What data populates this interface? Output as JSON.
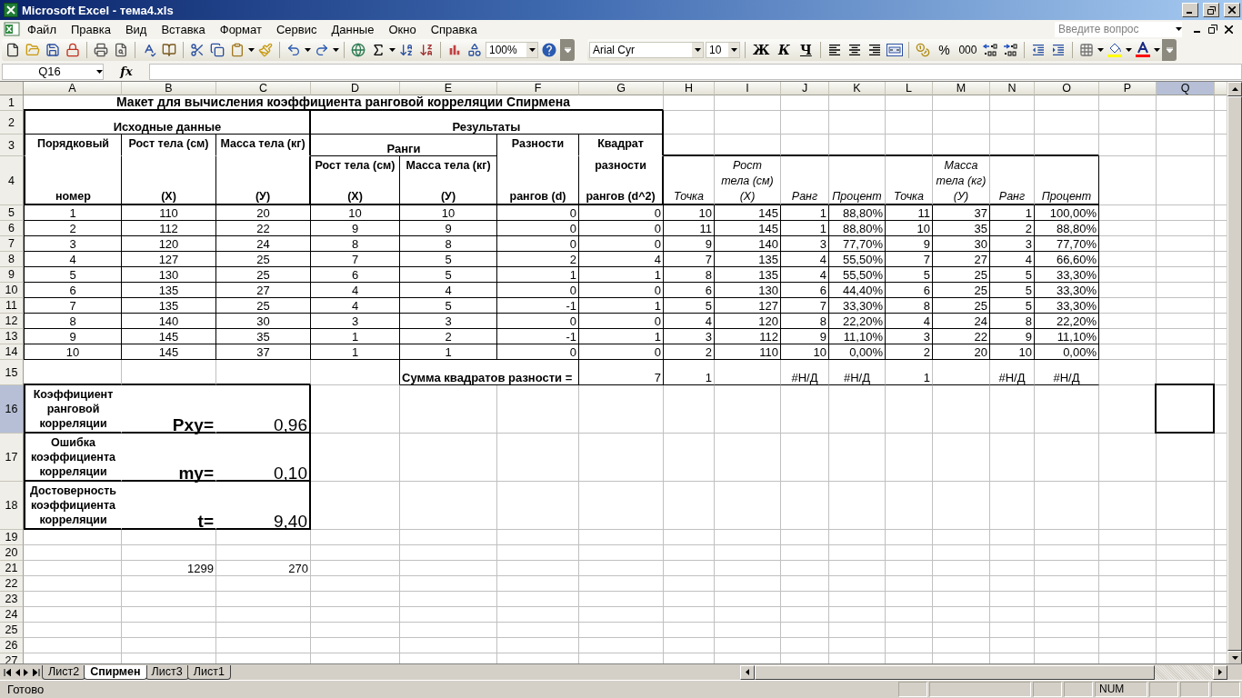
{
  "window": {
    "title": "Microsoft Excel - тема4.xls"
  },
  "menu": [
    "Файл",
    "Правка",
    "Вид",
    "Вставка",
    "Формат",
    "Сервис",
    "Данные",
    "Окно",
    "Справка"
  ],
  "help_search": {
    "placeholder": "Введите вопрос"
  },
  "standard_toolbar": {
    "zoom": "100%"
  },
  "formatting_toolbar": {
    "font": "Arial Cyr",
    "size": "10",
    "bold": "Ж",
    "italic": "К",
    "underline": "Ч",
    "percent": "%",
    "thousands": "000"
  },
  "formula_bar": {
    "name_box": "Q16",
    "fx": "fx"
  },
  "sheet": {
    "columns": [
      {
        "label": "A",
        "selected": false
      },
      {
        "label": "B",
        "selected": false
      },
      {
        "label": "C",
        "selected": false
      },
      {
        "label": "D",
        "selected": false
      },
      {
        "label": "E",
        "selected": false
      },
      {
        "label": "F",
        "selected": false
      },
      {
        "label": "G",
        "selected": false
      },
      {
        "label": "H",
        "selected": false
      },
      {
        "label": "I",
        "selected": false
      },
      {
        "label": "J",
        "selected": false
      },
      {
        "label": "K",
        "selected": false
      },
      {
        "label": "L",
        "selected": false
      },
      {
        "label": "M",
        "selected": false
      },
      {
        "label": "N",
        "selected": false
      },
      {
        "label": "O",
        "selected": false
      },
      {
        "label": "P",
        "selected": false
      },
      {
        "label": "Q",
        "selected": true
      }
    ],
    "rows": [
      {
        "label": "1",
        "selected": false,
        "cells": [
          {
            "text": "Макет для вычисления коэффициента ранговой корреляции  Спирмена",
            "kind": "title"
          }
        ]
      },
      {
        "label": "2",
        "selected": false,
        "cells": [
          {
            "text": "Исходные данные",
            "kind": "group"
          },
          null,
          null,
          {
            "text": "Результаты",
            "kind": "group"
          }
        ]
      },
      {
        "label": "3",
        "selected": false,
        "cells": [
          {
            "text": "Порядковый",
            "kind": "head-top"
          },
          {
            "text": "Рост  тела  (см)",
            "kind": "head-top"
          },
          {
            "text": "Масса тела (кг)",
            "kind": "head-top"
          },
          {
            "text": "Ранги",
            "kind": "group"
          },
          null,
          {
            "text": "Разности",
            "kind": "head-top"
          },
          {
            "text": "Квадрат",
            "kind": "head-top"
          }
        ]
      },
      {
        "label": "4",
        "selected": false,
        "cells": [
          {
            "text": "номер",
            "kind": "head"
          },
          {
            "text": "(X)",
            "kind": "head"
          },
          {
            "text": "(У)",
            "kind": "head"
          },
          {
            "lines": [
              "Рост тела (см)",
              "(X)"
            ],
            "kind": "head"
          },
          {
            "lines": [
              "Масса тела (кг)",
              "(У)"
            ],
            "kind": "head"
          },
          {
            "text": "рангов (d)",
            "kind": "head"
          },
          {
            "lines": [
              "разности",
              "рангов (d^2)"
            ],
            "kind": "head"
          },
          {
            "text": "Точка",
            "kind": "italic"
          },
          {
            "lines": [
              "Рост",
              "тела (см)",
              "(X)"
            ],
            "kind": "italic"
          },
          {
            "text": "Ранг",
            "kind": "italic"
          },
          {
            "text": "Процент",
            "kind": "italic"
          },
          {
            "text": "Точка",
            "kind": "italic"
          },
          {
            "lines": [
              "Масса",
              "тела (кг)",
              "(У)"
            ],
            "kind": "italic"
          },
          {
            "text": "Ранг",
            "kind": "italic"
          },
          {
            "text": "Процент",
            "kind": "italic"
          }
        ]
      },
      {
        "label": "5",
        "selected": false,
        "values": [
          "1",
          "110",
          "20",
          "10",
          "10",
          "0",
          "0",
          "10",
          "145",
          "1",
          "88,80%",
          "11",
          "37",
          "1",
          "100,00%"
        ]
      },
      {
        "label": "6",
        "selected": false,
        "values": [
          "2",
          "112",
          "22",
          "9",
          "9",
          "0",
          "0",
          "11",
          "145",
          "1",
          "88,80%",
          "10",
          "35",
          "2",
          "88,80%"
        ]
      },
      {
        "label": "7",
        "selected": false,
        "values": [
          "3",
          "120",
          "24",
          "8",
          "8",
          "0",
          "0",
          "9",
          "140",
          "3",
          "77,70%",
          "9",
          "30",
          "3",
          "77,70%"
        ]
      },
      {
        "label": "8",
        "selected": false,
        "values": [
          "4",
          "127",
          "25",
          "7",
          "5",
          "2",
          "4",
          "7",
          "135",
          "4",
          "55,50%",
          "7",
          "27",
          "4",
          "66,60%"
        ]
      },
      {
        "label": "9",
        "selected": false,
        "values": [
          "5",
          "130",
          "25",
          "6",
          "5",
          "1",
          "1",
          "8",
          "135",
          "4",
          "55,50%",
          "5",
          "25",
          "5",
          "33,30%"
        ]
      },
      {
        "label": "10",
        "selected": false,
        "values": [
          "6",
          "135",
          "27",
          "4",
          "4",
          "0",
          "0",
          "6",
          "130",
          "6",
          "44,40%",
          "6",
          "25",
          "5",
          "33,30%"
        ]
      },
      {
        "label": "11",
        "selected": false,
        "values": [
          "7",
          "135",
          "25",
          "4",
          "5",
          "-1",
          "1",
          "5",
          "127",
          "7",
          "33,30%",
          "8",
          "25",
          "5",
          "33,30%"
        ]
      },
      {
        "label": "12",
        "selected": false,
        "values": [
          "8",
          "140",
          "30",
          "3",
          "3",
          "0",
          "0",
          "4",
          "120",
          "8",
          "22,20%",
          "4",
          "24",
          "8",
          "22,20%"
        ]
      },
      {
        "label": "13",
        "selected": false,
        "values": [
          "9",
          "145",
          "35",
          "1",
          "2",
          "-1",
          "1",
          "3",
          "112",
          "9",
          "11,10%",
          "3",
          "22",
          "9",
          "11,10%"
        ]
      },
      {
        "label": "14",
        "selected": false,
        "values": [
          "10",
          "145",
          "37",
          "1",
          "1",
          "0",
          "0",
          "2",
          "110",
          "10",
          "0,00%",
          "2",
          "20",
          "10",
          "0,00%"
        ]
      },
      {
        "label": "15",
        "selected": false,
        "cells": [
          null,
          null,
          null,
          null,
          {
            "text": "Сумма квадратов разности =",
            "kind": "label"
          },
          null,
          {
            "text": "7",
            "kind": "num"
          },
          {
            "text": "1",
            "kind": "num"
          },
          null,
          {
            "text": "#Н/Д",
            "kind": "error"
          },
          {
            "text": "#Н/Д",
            "kind": "error"
          },
          {
            "text": "1",
            "kind": "num"
          },
          null,
          {
            "text": "#Н/Д",
            "kind": "error"
          },
          {
            "text": "#Н/Д",
            "kind": "error"
          }
        ]
      },
      {
        "label": "16",
        "selected": true,
        "cells": [
          {
            "text": "Коэффициент ранговой корреляции",
            "kind": "note"
          },
          {
            "text": "Рху=",
            "kind": "big-label"
          },
          {
            "text": "0,96",
            "kind": "big-value"
          }
        ]
      },
      {
        "label": "17",
        "selected": false,
        "cells": [
          {
            "text": "Ошибка коэффициента корреляции",
            "kind": "note"
          },
          {
            "text": "my=",
            "kind": "big-label"
          },
          {
            "text": "0,10",
            "kind": "big-value"
          }
        ]
      },
      {
        "label": "18",
        "selected": false,
        "cells": [
          {
            "text": "Достоверность коэффициента корреляции",
            "kind": "note"
          },
          {
            "text": "t=",
            "kind": "big-label"
          },
          {
            "text": "9,40",
            "kind": "big-value"
          }
        ]
      },
      {
        "label": "19",
        "selected": false
      },
      {
        "label": "20",
        "selected": false
      },
      {
        "label": "21",
        "selected": false,
        "cells": [
          null,
          {
            "text": "1299",
            "kind": "num"
          },
          {
            "text": "270",
            "kind": "num"
          }
        ]
      },
      {
        "label": "22",
        "selected": false
      },
      {
        "label": "23",
        "selected": false
      },
      {
        "label": "24",
        "selected": false
      },
      {
        "label": "25",
        "selected": false
      },
      {
        "label": "26",
        "selected": false
      },
      {
        "label": "27",
        "selected": false
      }
    ]
  },
  "sheet_tabs": [
    {
      "label": "Лист2",
      "selected": false
    },
    {
      "label": "Спирмен",
      "selected": true
    },
    {
      "label": "Лист3",
      "selected": false
    },
    {
      "label": "Лист1",
      "selected": false
    }
  ],
  "status_bar": {
    "text": "Готово",
    "indicator": "NUM"
  }
}
